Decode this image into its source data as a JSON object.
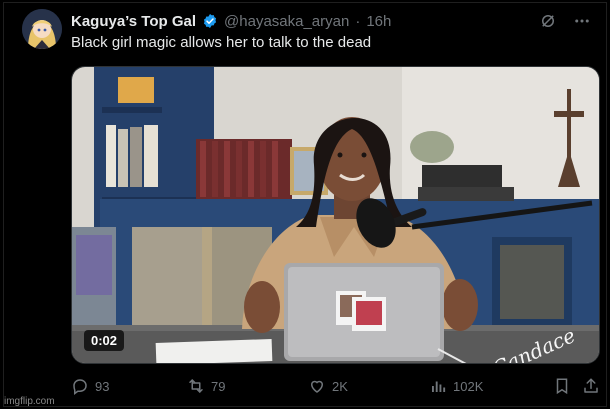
{
  "tweet": {
    "display_name": "Kaguya’s Top Gal",
    "handle": "@hayasaka_aryan",
    "separator": "·",
    "time": "16h",
    "text": "Black girl magic allows her to talk to the dead",
    "verified_color": "#1d9bf0"
  },
  "media": {
    "duration": "0:02",
    "overlay_text": "Candace"
  },
  "actions": {
    "replies": "93",
    "reposts": "79",
    "likes": "2K",
    "views": "102K"
  },
  "icons": {
    "top": [
      "grok-icon",
      "more-icon"
    ],
    "actions": [
      "reply-icon",
      "repost-icon",
      "like-icon",
      "views-icon",
      "bookmark-icon",
      "share-icon"
    ]
  },
  "footer": {
    "watermark": "imgflip.com"
  }
}
